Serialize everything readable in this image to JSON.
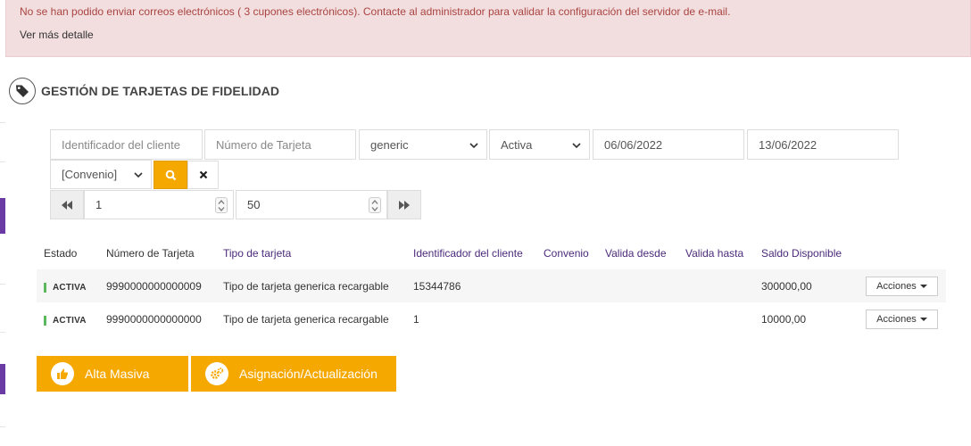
{
  "alert": {
    "message": "No se han podido enviar correos electrónicos ( 3 cupones electrónicos). Contacte al administrador para validar la configuración del servidor de e-mail.",
    "detail_link": "Ver más detalle"
  },
  "page": {
    "title": "GESTIÓN DE TARJETAS DE FIDELIDAD",
    "title_icon": "tag-icon"
  },
  "filters": {
    "client_id_placeholder": "Identificador del cliente",
    "card_number_placeholder": "Número de Tarjeta",
    "card_type_value": "generic",
    "status_value": "Activa",
    "date_from": "06/06/2022",
    "date_to": "13/06/2022",
    "agreement_value": "[Convenio]"
  },
  "pager": {
    "page": "1",
    "page_size": "50"
  },
  "table": {
    "headers": [
      "Estado",
      "Número de Tarjeta",
      "Tipo de tarjeta",
      "Identificador del cliente",
      "Convenio",
      "Valida desde",
      "Valida hasta",
      "Saldo Disponible"
    ],
    "rows": [
      {
        "status": "ACTIVA",
        "card_number": "9990000000000009",
        "card_type": "Tipo de tarjeta generica recargable",
        "client_id": "15344786",
        "agreement": "",
        "valid_from": "",
        "valid_to": "",
        "balance": "300000,00",
        "action": "Acciones"
      },
      {
        "status": "ACTIVA",
        "card_number": "9990000000000000",
        "card_type": "Tipo de tarjeta generica recargable",
        "client_id": "1",
        "agreement": "",
        "valid_from": "",
        "valid_to": "",
        "balance": "10000,00",
        "action": "Acciones"
      }
    ]
  },
  "buttons": {
    "bulk_add": "Alta Masiva",
    "assign_update": "Asignación/Actualización"
  },
  "colors": {
    "accent": "#f5a800",
    "brand_purple": "#6a3aa5",
    "alert_bg": "#f2dede",
    "alert_text": "#a94442",
    "status_active": "#5cb85c"
  }
}
